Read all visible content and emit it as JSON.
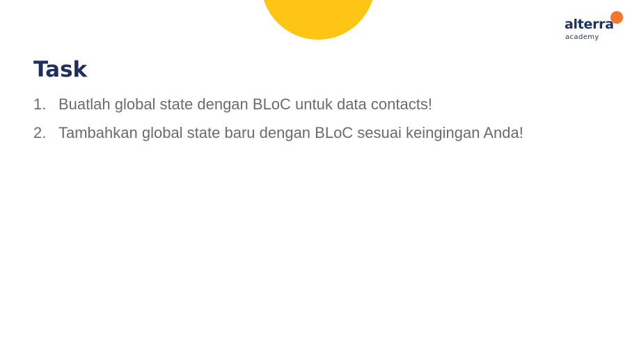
{
  "colors": {
    "background": "#ffffff",
    "accent_yellow": "#fec514",
    "brand_orange": "#f4772c",
    "title_navy": "#1c2f5e",
    "logo_navy": "#1d3461",
    "body_gray": "#6b6b6b"
  },
  "brand": {
    "name": "alterra",
    "subtitle": "academy"
  },
  "slide": {
    "title": "Task",
    "tasks": [
      {
        "number": "1.",
        "text": "Buatlah global state dengan BLoC untuk data contacts!"
      },
      {
        "number": "2.",
        "text": "Tambahkan global state baru dengan BLoC sesuai keingingan Anda!"
      }
    ]
  }
}
